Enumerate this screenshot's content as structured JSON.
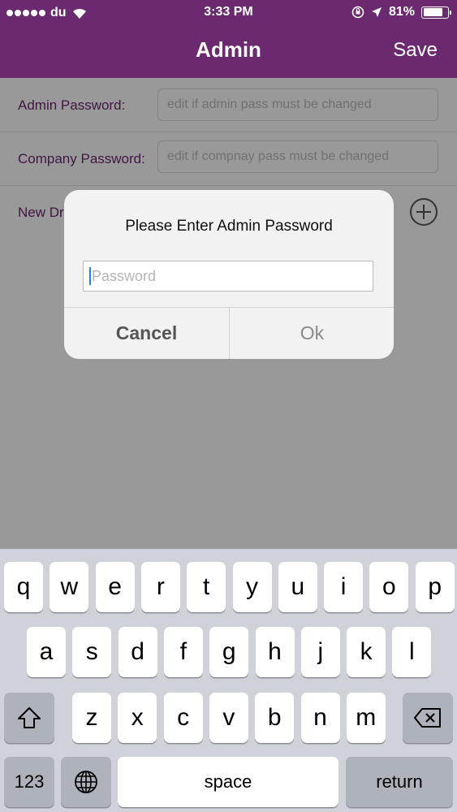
{
  "status_bar": {
    "carrier": "du",
    "time": "3:33 PM",
    "battery": "81%",
    "battery_level": 0.81,
    "signal_icon": "signal-dots-icon",
    "wifi_icon": "wifi-icon",
    "lock_icon": "orientation-lock-icon",
    "location_icon": "location-arrow-icon"
  },
  "nav": {
    "title": "Admin",
    "save_label": "Save",
    "bar_color": "#6b2a6f"
  },
  "form": {
    "admin_password_label": "Admin Password:",
    "admin_password_placeholder": "edit if admin pass must be changed",
    "company_password_label": "Company Password:",
    "company_password_placeholder": "edit if compnay pass must be changed",
    "new_row_label": "New Dr",
    "add_icon": "plus-circle-icon"
  },
  "alert": {
    "message": "Please Enter Admin Password",
    "password_placeholder": "Password",
    "cancel_label": "Cancel",
    "ok_label": "Ok"
  },
  "keyboard": {
    "row1": [
      "q",
      "w",
      "e",
      "r",
      "t",
      "y",
      "u",
      "i",
      "o",
      "p"
    ],
    "row2": [
      "a",
      "s",
      "d",
      "f",
      "g",
      "h",
      "j",
      "k",
      "l"
    ],
    "row3": [
      "z",
      "x",
      "c",
      "v",
      "b",
      "n",
      "m"
    ],
    "numbers_label": "123",
    "space_label": "space",
    "return_label": "return",
    "shift_icon": "shift-icon",
    "delete_icon": "backspace-icon",
    "globe_icon": "globe-icon"
  }
}
